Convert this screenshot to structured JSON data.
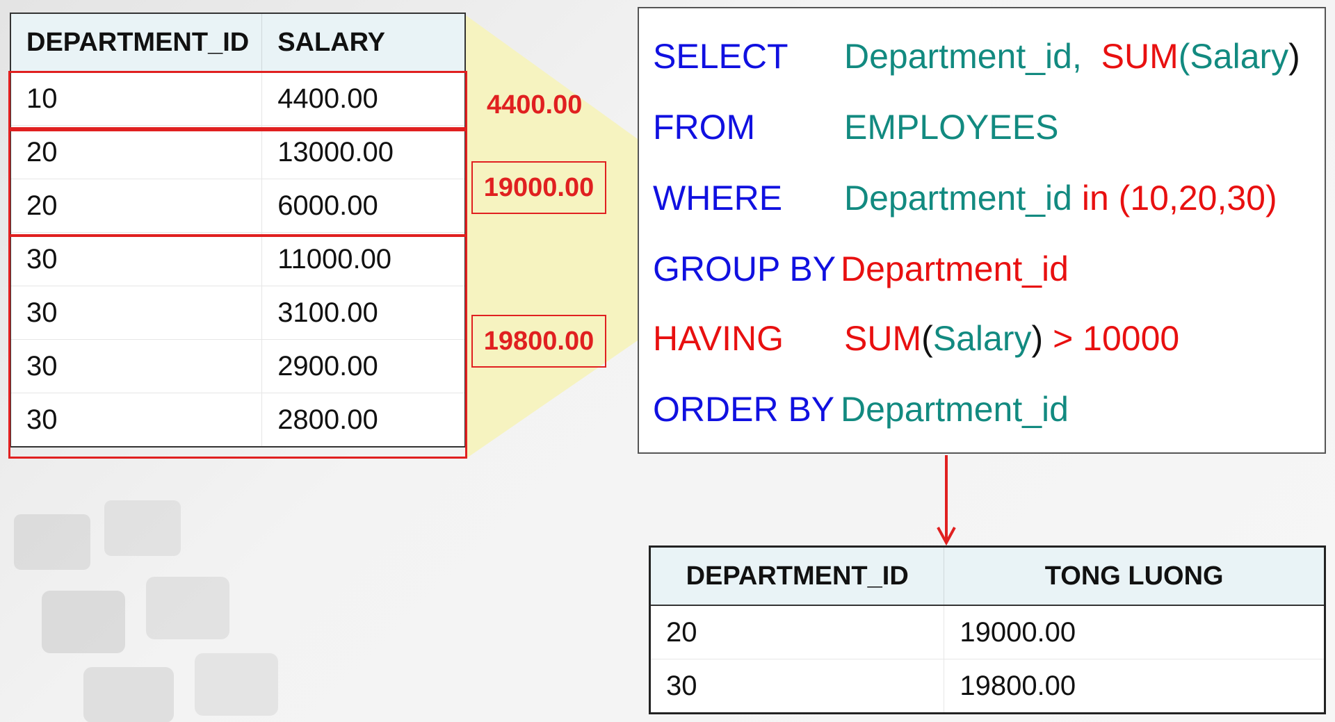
{
  "source_table": {
    "columns": [
      "DEPARTMENT_ID",
      "SALARY"
    ],
    "rows": [
      [
        "10",
        "4400.00"
      ],
      [
        "20",
        "13000.00"
      ],
      [
        "20",
        "6000.00"
      ],
      [
        "30",
        "11000.00"
      ],
      [
        "30",
        "3100.00"
      ],
      [
        "30",
        "2900.00"
      ],
      [
        "30",
        "2800.00"
      ]
    ]
  },
  "group_sums": [
    "4400.00",
    "19000.00",
    "19800.00"
  ],
  "sql": {
    "select_kw": "SELECT",
    "select_col": "Department_id,",
    "select_fn": "SUM",
    "select_open": "(",
    "select_arg": "Salary",
    "select_close": ")",
    "from_kw": "FROM",
    "from_table": "EMPLOYEES",
    "where_kw": "WHERE",
    "where_col": "Department_id",
    "where_cond": "in (10,20,30)",
    "groupby_kw": "GROUP BY",
    "groupby_col": "Department_id",
    "having_kw": "HAVING",
    "having_fn": "SUM",
    "having_open": "(",
    "having_arg": "Salary",
    "having_close": ")",
    "having_cond": "> 10000",
    "orderby_kw": "ORDER BY",
    "orderby_col": "Department_id"
  },
  "result_table": {
    "columns": [
      "DEPARTMENT_ID",
      "TONG LUONG"
    ],
    "rows": [
      [
        "20",
        "19000.00"
      ],
      [
        "30",
        "19800.00"
      ]
    ]
  },
  "colors": {
    "keyword_blue": "#1010e0",
    "identifier_teal": "#128a80",
    "highlight_red": "#e81010",
    "header_bg": "#e9f3f6"
  }
}
